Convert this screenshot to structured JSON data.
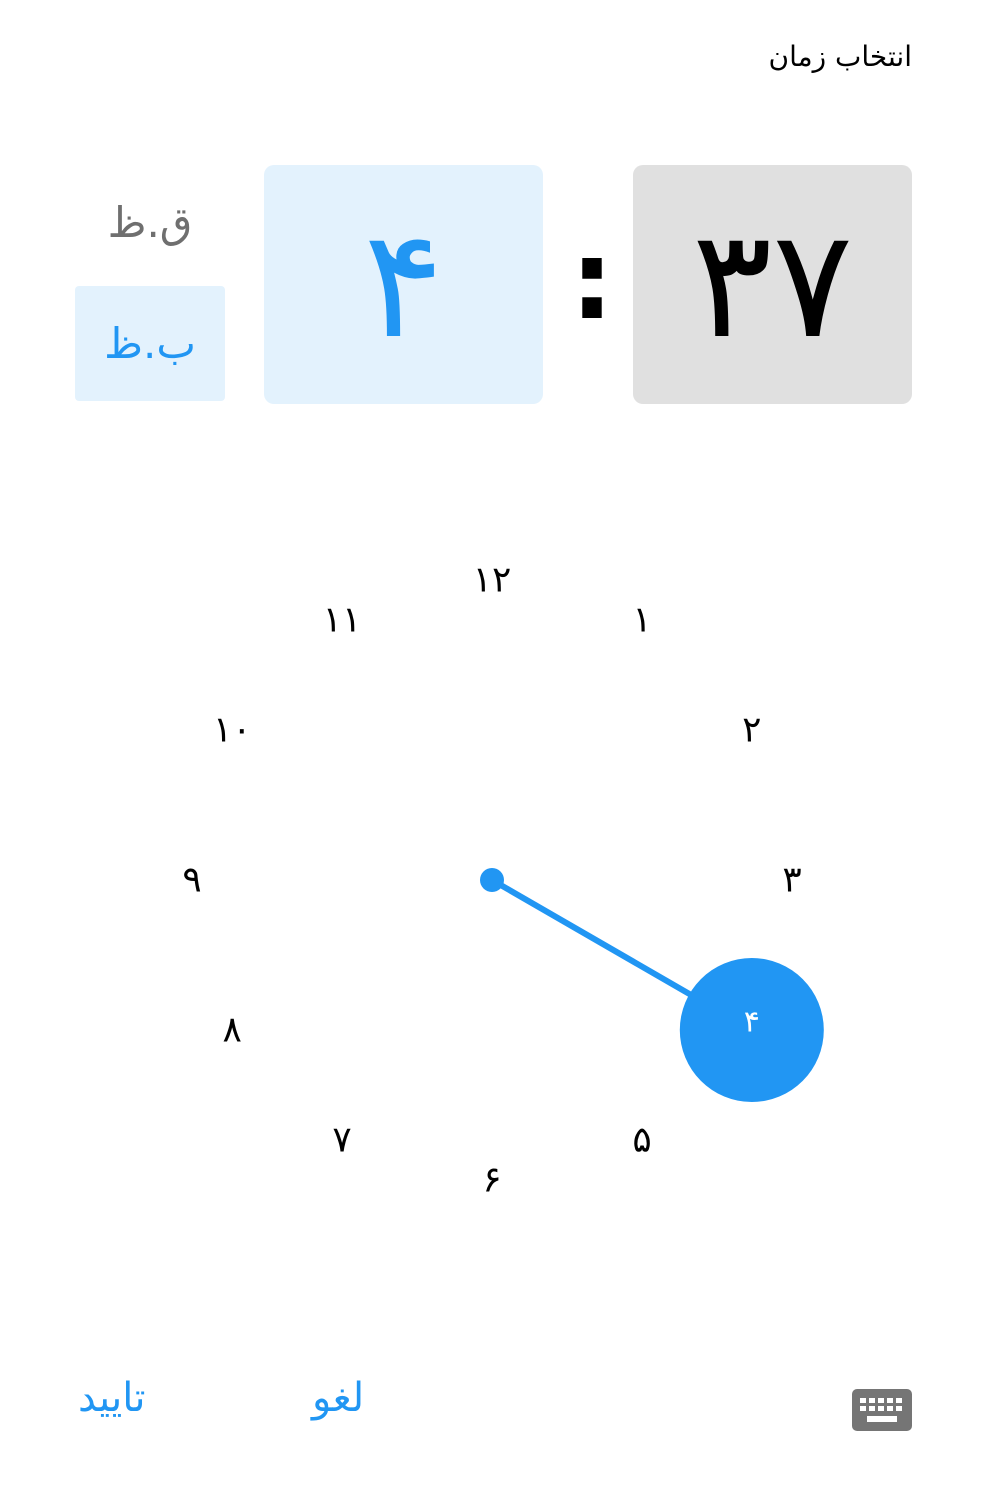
{
  "dialog": {
    "title": "انتخاب زمان"
  },
  "time": {
    "hour": "۴",
    "minute": "۳۷",
    "separator": ":"
  },
  "period": {
    "am_label": "ق.ظ",
    "pm_label": "ب.ظ",
    "selected": "pm"
  },
  "clock": {
    "numbers": [
      "۱۲",
      "۱",
      "۲",
      "۳",
      "۴",
      "۵",
      "۶",
      "۷",
      "۸",
      "۹",
      "۱۰",
      "۱۱"
    ],
    "selected_hour": 4,
    "selected_label": "۴"
  },
  "actions": {
    "confirm_label": "تایید",
    "cancel_label": "لغو"
  },
  "icons": {
    "keyboard": "keyboard-icon"
  },
  "colors": {
    "accent": "#2196f3",
    "accent_light": "#e3f2fd",
    "inactive_box": "#e0e0e0",
    "inactive_text": "#6f6f6f"
  }
}
